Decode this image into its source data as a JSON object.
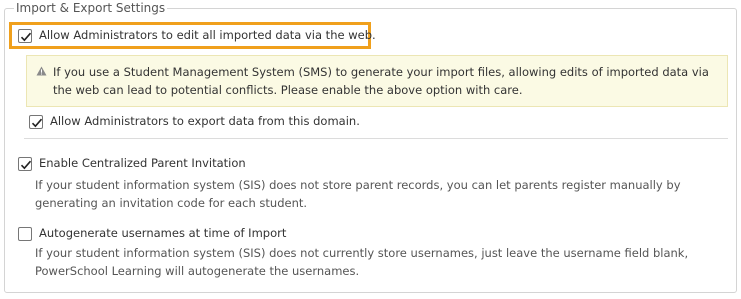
{
  "section": {
    "title": "Import & Export Settings"
  },
  "options": {
    "allow_edit": {
      "label": "Allow Administrators to edit all imported data via the web.",
      "checked": true
    },
    "warning": {
      "text": "If you use a Student Management System (SMS) to generate your import files, allowing edits of imported data via the web can lead to potential conflicts. Please enable the above option with care.",
      "icon": "warning-triangle-icon"
    },
    "allow_export": {
      "label": "Allow Administrators to export data from this domain.",
      "checked": true
    },
    "parent_invitation": {
      "label": "Enable Centralized Parent Invitation",
      "checked": true,
      "description": "If your student information system (SIS) does not store parent records, you can let parents register manually by generating an invitation code for each student."
    },
    "autogenerate_usernames": {
      "label": "Autogenerate usernames at time of Import",
      "checked": false,
      "description": "If your student information system (SIS) does not currently store usernames, just leave the username field blank, PowerSchool Learning will autogenerate the usernames."
    }
  },
  "colors": {
    "highlight": "#f0a01c",
    "warning_bg": "#fbfae4",
    "warning_border": "#ece6b4"
  }
}
